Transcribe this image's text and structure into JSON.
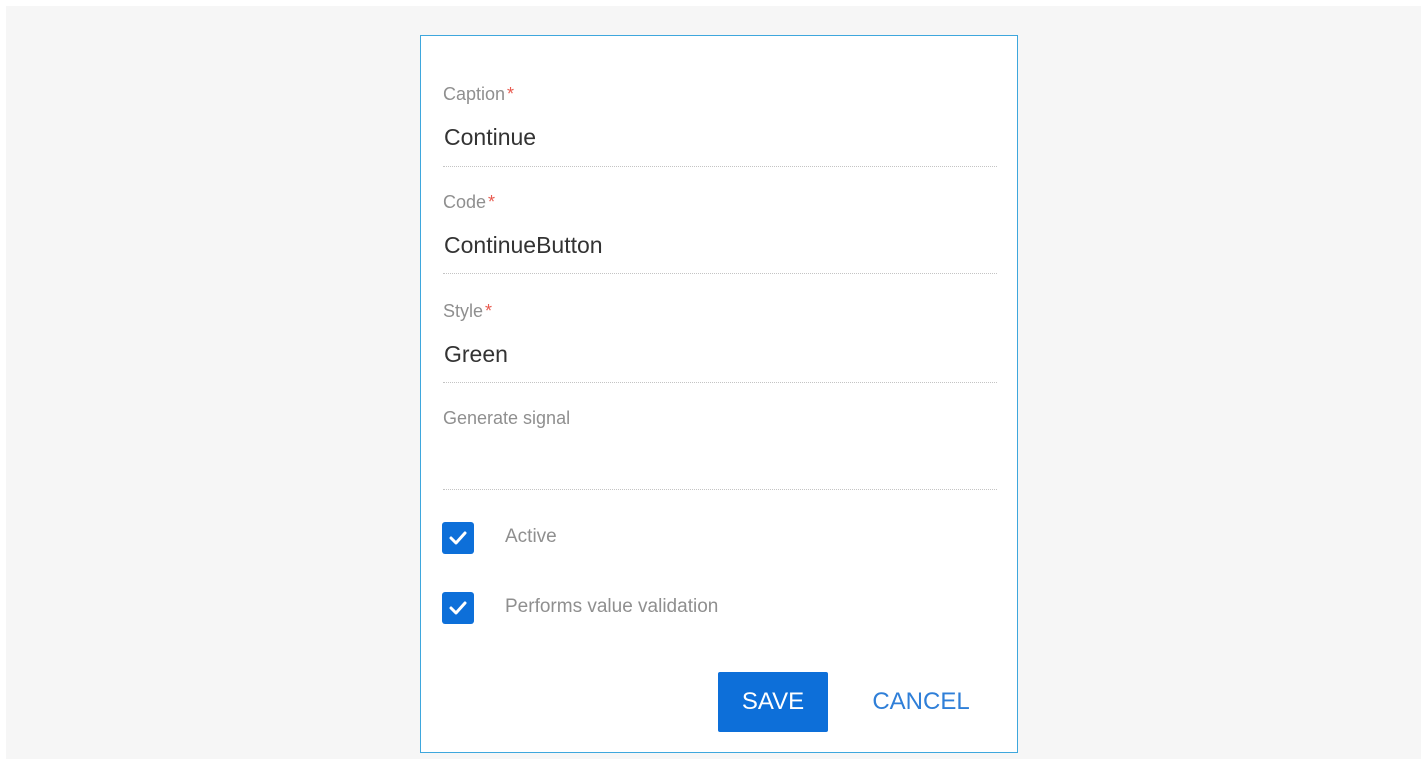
{
  "dialog": {
    "fields": [
      {
        "label": "Caption",
        "required_mark": "*",
        "value": "Continue"
      },
      {
        "label": "Code",
        "required_mark": "*",
        "value": "ContinueButton"
      },
      {
        "label": "Style",
        "required_mark": "*",
        "value": "Green"
      },
      {
        "label": "Generate signal",
        "value": ""
      }
    ],
    "checkboxes": [
      {
        "label": "Active",
        "checked": true
      },
      {
        "label": "Performs value validation",
        "checked": true
      }
    ],
    "buttons": {
      "save": "SAVE",
      "cancel": "CANCEL"
    },
    "colors": {
      "border": "#3ea7dd",
      "accent": "#0d6fd9",
      "required": "#e85a4f",
      "link": "#2f7fd8"
    },
    "icons": {
      "checkbox": "checkmark-icon"
    }
  }
}
